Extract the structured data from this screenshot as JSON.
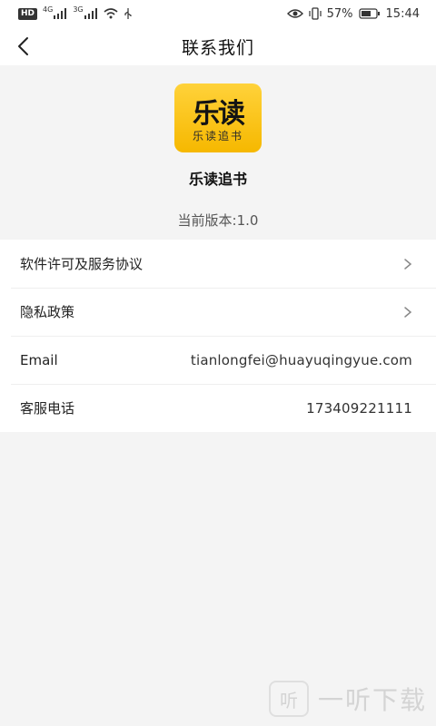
{
  "statusbar": {
    "hd": "HD",
    "sig1": "4G",
    "sig2": "3G",
    "battery": "57%",
    "time": "15:44"
  },
  "appbar": {
    "title": "联系我们",
    "back_icon": "chevron-left-icon"
  },
  "app": {
    "logo_main": "乐读",
    "logo_sub": "乐读追书",
    "name": "乐读追书",
    "version": "当前版本:1.0"
  },
  "list": [
    {
      "label": "软件许可及服务协议",
      "value": "",
      "chevron": true
    },
    {
      "label": "隐私政策",
      "value": "",
      "chevron": true
    },
    {
      "label": "Email",
      "value": "tianlongfei@huayuqingyue.com",
      "chevron": false
    },
    {
      "label": "客服电话",
      "value": "173409221111",
      "chevron": false
    }
  ],
  "watermark": {
    "mark": "听",
    "text": "一听下载"
  },
  "colors": {
    "logo_bg": "#f6b800",
    "page_bg": "#f4f4f4"
  }
}
